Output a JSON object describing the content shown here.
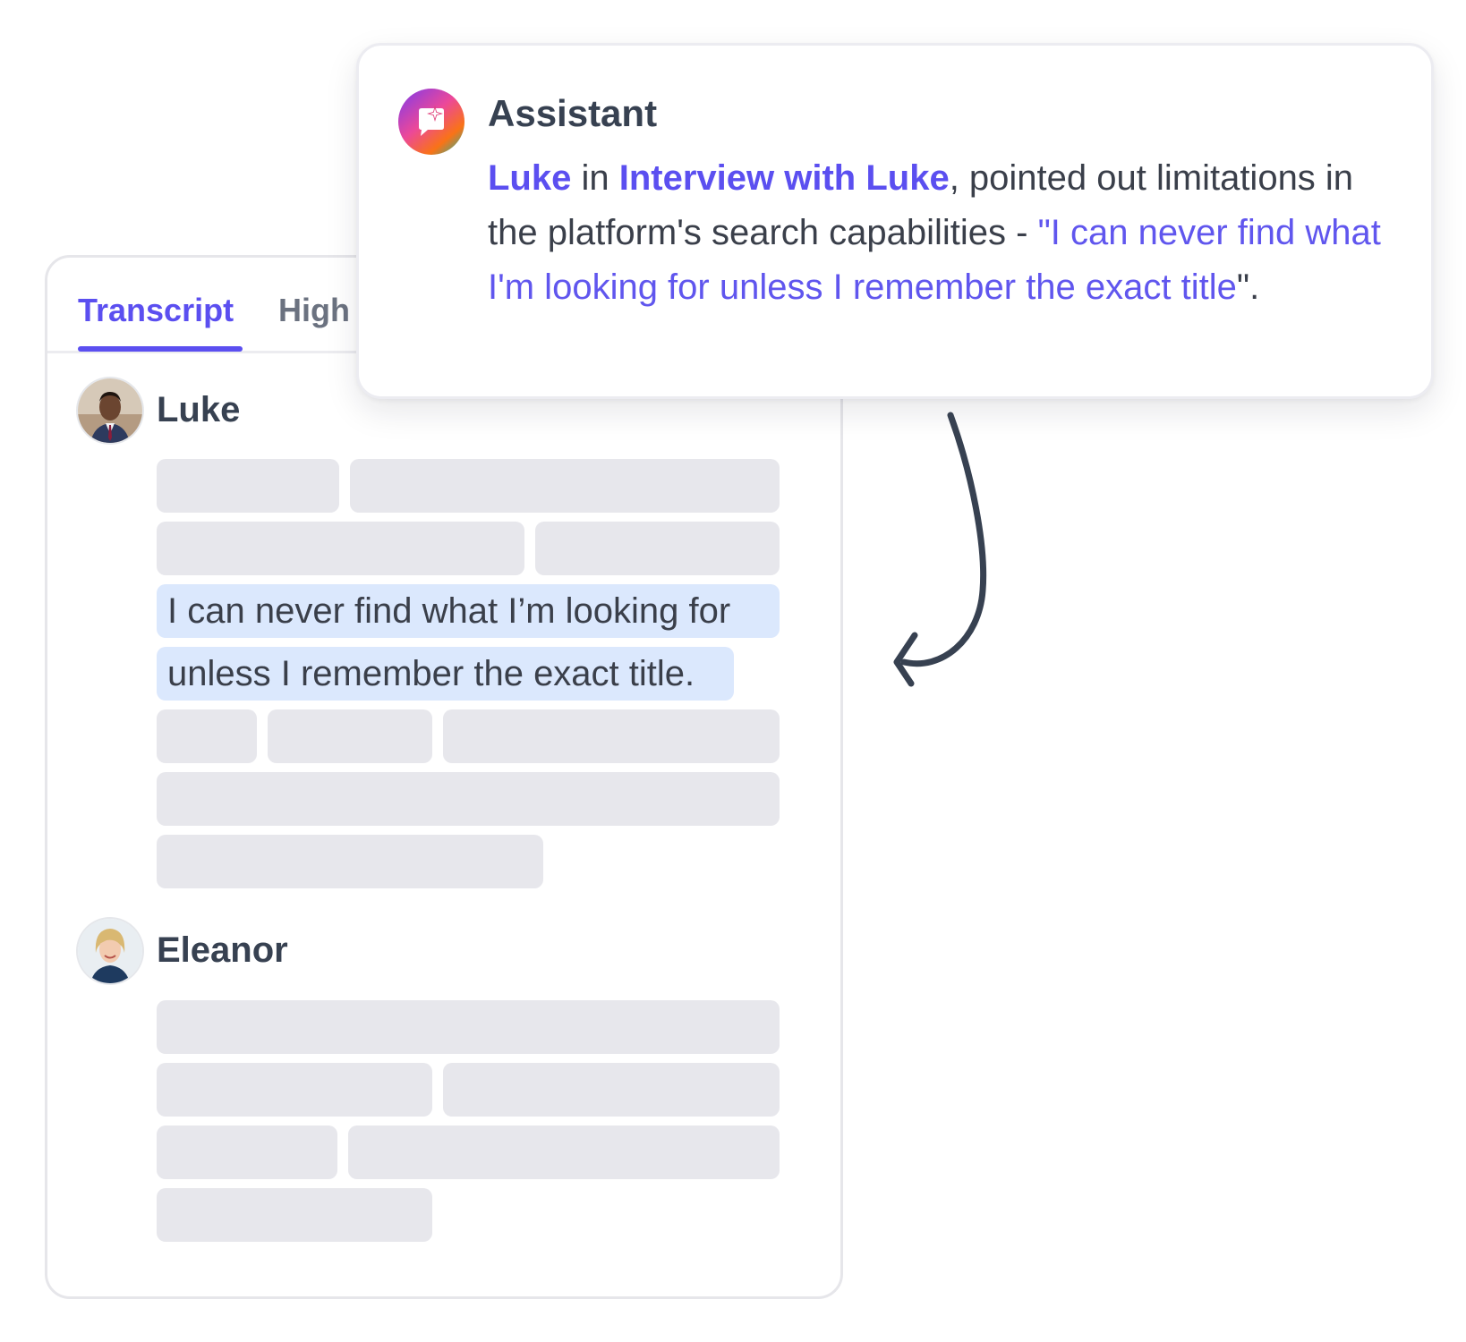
{
  "tabs": {
    "transcript": "Transcript",
    "highlights": "High"
  },
  "transcript": {
    "speakers": [
      {
        "name": "Luke"
      },
      {
        "name": "Eleanor"
      }
    ],
    "highlight_lines": [
      "I can never find what I’m looking for",
      "unless I remember the exact title."
    ]
  },
  "assistant": {
    "name": "Assistant",
    "speaker_link": "Luke",
    "in_text": " in ",
    "interview_link": "Interview with Luke",
    "summary": ", pointed out limitations in the platform's search capabilities - ",
    "quote_open": "\"",
    "quote": "I can never find what I'm looking for unless I remember the exact title",
    "quote_close": "\"."
  },
  "colors": {
    "accent": "#5b4ff0",
    "highlight": "#dbe8fd",
    "skeleton": "#e7e7ec"
  },
  "icons": {
    "assistant": "assistant-sparkle-chat-icon",
    "arrow": "curved-arrow-icon"
  }
}
